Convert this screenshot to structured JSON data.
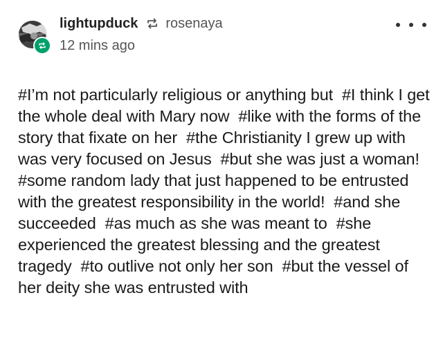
{
  "post": {
    "author": "lightupduck",
    "reblog_icon": "reblog-icon",
    "source": "rosenaya",
    "timestamp": "12 mins ago",
    "more_icon": "more-horizontal-icon",
    "tags": [
      "#I’m not particularly religious or anything but",
      "#I think I get the whole deal with Mary now",
      "#like with the forms of the story that fixate on her",
      "#the Christianity I grew up with was very focused on Jesus",
      "#but she was just a woman!",
      "#some random lady that just happened to be entrusted with the greatest responsibility in the world!",
      "#and she succeeded",
      "#as much as she was meant to",
      "#she experienced the greatest blessing and the greatest tragedy",
      "#to outlive not only her son",
      "#but the vessel of her deity she was entrusted with"
    ]
  },
  "colors": {
    "reblog_badge": "#00a06a",
    "text": "#1a1a1a",
    "muted": "#555555"
  }
}
